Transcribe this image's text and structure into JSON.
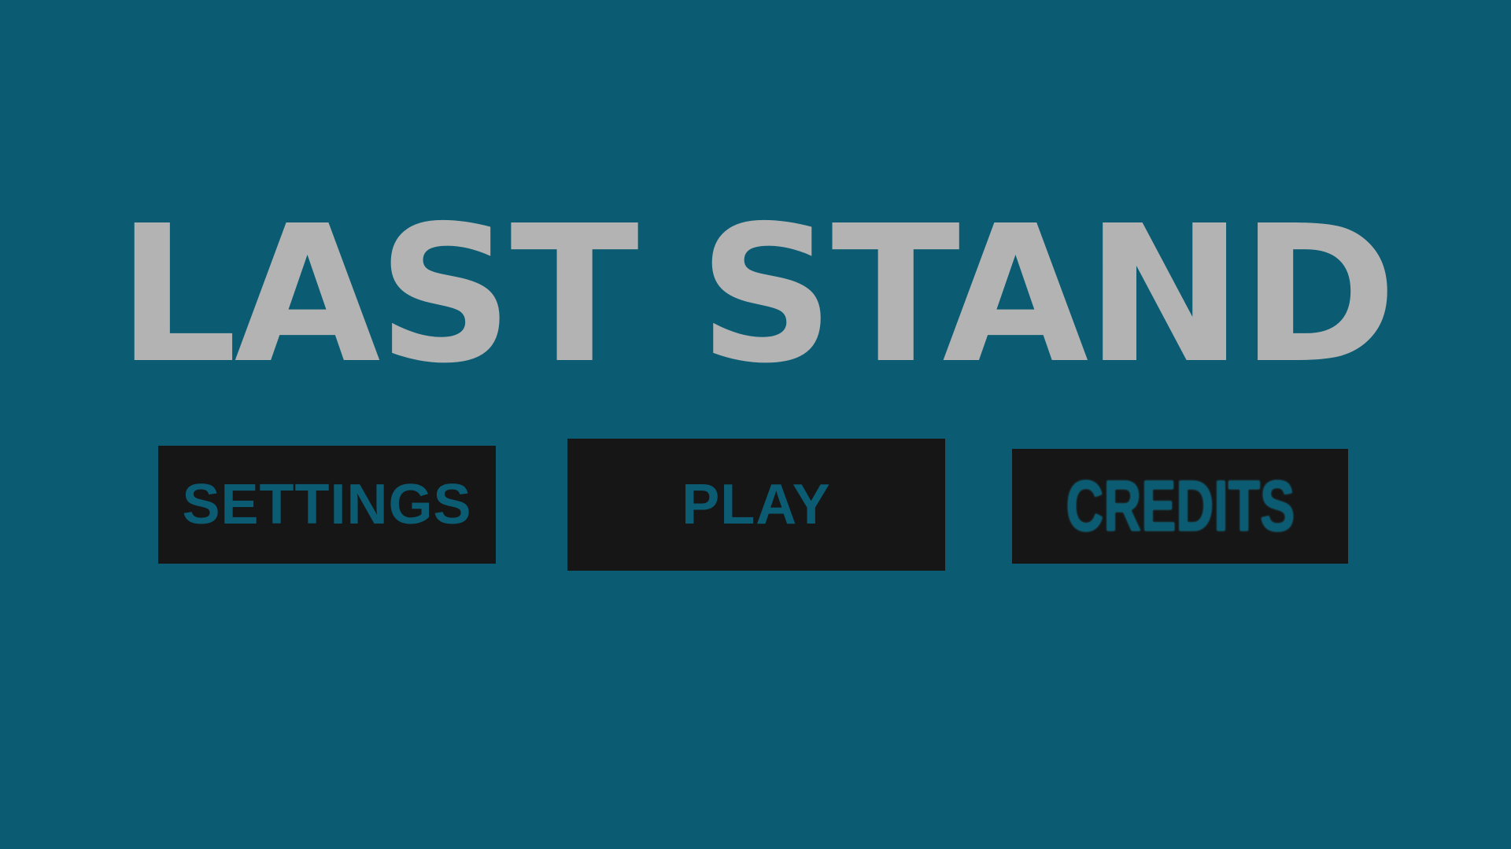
{
  "game": {
    "title": "LAST STAND"
  },
  "menu": {
    "settings_label": "SETTINGS",
    "play_label": "PLAY",
    "credits_label": "CREDITS"
  },
  "colors": {
    "background": "#0b5c72",
    "title_text": "#b3b3b3",
    "button_bg": "#161616",
    "button_text": "#0b5c72"
  }
}
